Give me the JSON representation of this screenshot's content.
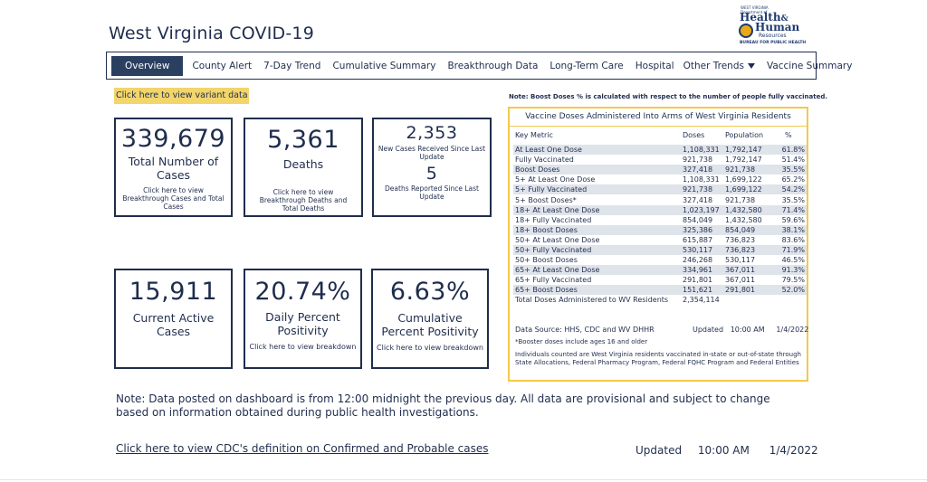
{
  "header": {
    "title": "West Virginia COVID-19",
    "logo": {
      "state": "WEST VIRGINIA",
      "dept": "Department of",
      "line1": "Health",
      "amp": "&",
      "line2": "Human",
      "line3": "Resources",
      "line4": "BUREAU FOR PUBLIC HEALTH"
    }
  },
  "nav": {
    "tabs": [
      {
        "label": "Overview"
      },
      {
        "label": "County Alert"
      },
      {
        "label": "7-Day Trend"
      },
      {
        "label": "Cumulative Summary"
      },
      {
        "label": "Breakthrough Data"
      },
      {
        "label": "Long-Term Care"
      },
      {
        "label": "Hospital"
      },
      {
        "label": "Other Trends"
      },
      {
        "label": "Vaccine Summary"
      }
    ]
  },
  "variant_link": "Click here to view variant data",
  "cards": {
    "total_cases": {
      "value": "339,679",
      "label": "Total Number of Cases",
      "link": "Click here to view Breakthrough Cases and Total Cases"
    },
    "deaths": {
      "value": "5,361",
      "label": "Deaths",
      "link": "Click here to view Breakthrough Deaths and Total Deaths"
    },
    "new_cases": {
      "value": "2,353",
      "label": "New Cases Received Since Last Update"
    },
    "new_deaths": {
      "value": "5",
      "label": "Deaths Reported Since Last Update"
    },
    "active": {
      "value": "15,911",
      "label": "Current Active Cases"
    },
    "daily_pct": {
      "value": "20.74%",
      "label": "Daily Percent Positivity",
      "link": "Click here to view breakdown"
    },
    "cum_pct": {
      "value": "6.63%",
      "label": "Cumulative Percent Positivity",
      "link": "Click here to view breakdown"
    }
  },
  "vaccine": {
    "note": "Note: Boost Doses % is calculated with respect to the number of people fully vaccinated.",
    "title": "Vaccine Doses Administered Into Arms of West Virginia Residents",
    "headers": [
      "Key Metric",
      "Doses",
      "Population",
      "%"
    ],
    "rows": [
      [
        "At Least One Dose",
        "1,108,331",
        "1,792,147",
        "61.8%"
      ],
      [
        "Fully Vaccinated",
        "921,738",
        "1,792,147",
        "51.4%"
      ],
      [
        "Boost Doses",
        "327,418",
        "921,738",
        "35.5%"
      ],
      [
        "5+ At Least One Dose",
        "1,108,331",
        "1,699,122",
        "65.2%"
      ],
      [
        "5+ Fully Vaccinated",
        "921,738",
        "1,699,122",
        "54.2%"
      ],
      [
        "5+ Boost Doses*",
        "327,418",
        "921,738",
        "35.5%"
      ],
      [
        "18+ At Least One Dose",
        "1,023,197",
        "1,432,580",
        "71.4%"
      ],
      [
        "18+ Fully Vaccinated",
        "854,049",
        "1,432,580",
        "59.6%"
      ],
      [
        "18+ Boost Doses",
        "325,386",
        "854,049",
        "38.1%"
      ],
      [
        "50+ At Least One Dose",
        "615,887",
        "736,823",
        "83.6%"
      ],
      [
        "50+ Fully Vaccinated",
        "530,117",
        "736,823",
        "71.9%"
      ],
      [
        "50+ Boost Doses",
        "246,268",
        "530,117",
        "46.5%"
      ],
      [
        "65+ At Least One Dose",
        "334,961",
        "367,011",
        "91.3%"
      ],
      [
        "65+ Fully Vaccinated",
        "291,801",
        "367,011",
        "79.5%"
      ],
      [
        "65+ Boost Doses",
        "151,621",
        "291,801",
        "52.0%"
      ]
    ],
    "total_label": "Total Doses Administered to WV Residents",
    "total_value": "2,354,114",
    "source": "Data Source: HHS, CDC and WV DHHR",
    "updated_label": "Updated",
    "updated_time": "10:00 AM",
    "updated_date": "1/4/2022",
    "booster_note": "*Booster doses include ages 16 and older",
    "individuals_note": "Individuals counted are West Virginia residents vaccinated in-state or out-of-state through State Allocations, Federal Pharmacy Program, Federal FQHC Program and Federal Entities"
  },
  "footer": {
    "note": "Note: Data posted on dashboard is from 12:00 midnight the previous day. All data are provisional and subject to change based on information obtained during public health investigations.",
    "cdc_link": "Click here to view CDC's definition on Confirmed and Probable cases",
    "updated_label": "Updated",
    "updated_time": "10:00 AM",
    "updated_date": "1/4/2022"
  }
}
